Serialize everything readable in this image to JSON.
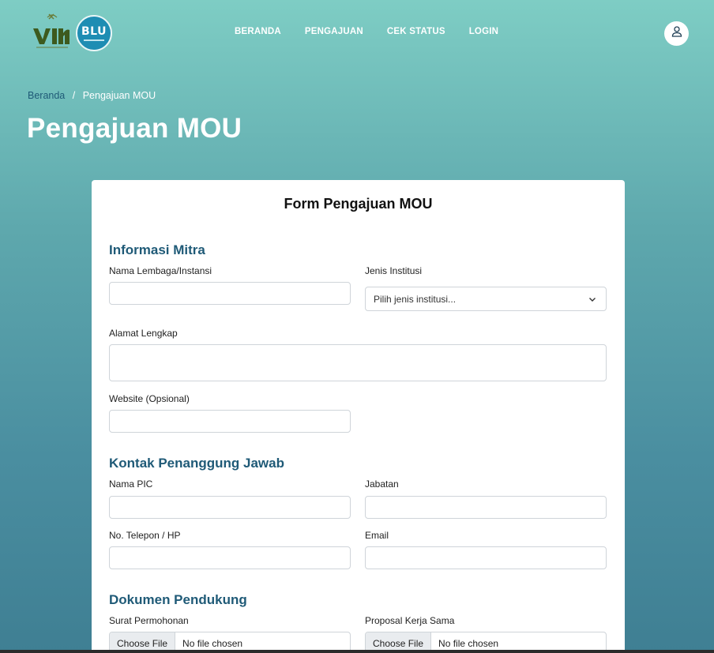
{
  "nav": {
    "logo_uin_text": "UIN",
    "logo_blu_text": "BLU",
    "menu": [
      "BERANDA",
      "PENGAJUAN",
      "CEK STATUS",
      "LOGIN"
    ],
    "user_icon": "user-icon"
  },
  "breadcrumb": {
    "home": "Beranda",
    "separator": "/",
    "current": "Pengajuan MOU"
  },
  "page_title": "Pengajuan MOU",
  "form": {
    "title": "Form Pengajuan MOU",
    "sections": {
      "mitra": {
        "title": "Informasi Mitra",
        "nama_label": "Nama Lembaga/Instansi",
        "jenis_label": "Jenis Institusi",
        "jenis_placeholder": "Pilih jenis institusi...",
        "alamat_label": "Alamat Lengkap",
        "website_label": "Website (Opsional)"
      },
      "kontak": {
        "title": "Kontak Penanggung Jawab",
        "pic_label": "Nama PIC",
        "jabatan_label": "Jabatan",
        "telepon_label": "No. Telepon / HP",
        "email_label": "Email"
      },
      "dokumen": {
        "title": "Dokumen Pendukung",
        "surat_label": "Surat Permohonan",
        "proposal_label": "Proposal Kerja Sama",
        "choose_file": "Choose File",
        "no_file": "No file chosen"
      }
    }
  },
  "colors": {
    "accent": "#1f5a77",
    "bg_top": "#7ecdc4",
    "bg_bottom": "#3f7f93",
    "blu": "#1e8db3"
  }
}
